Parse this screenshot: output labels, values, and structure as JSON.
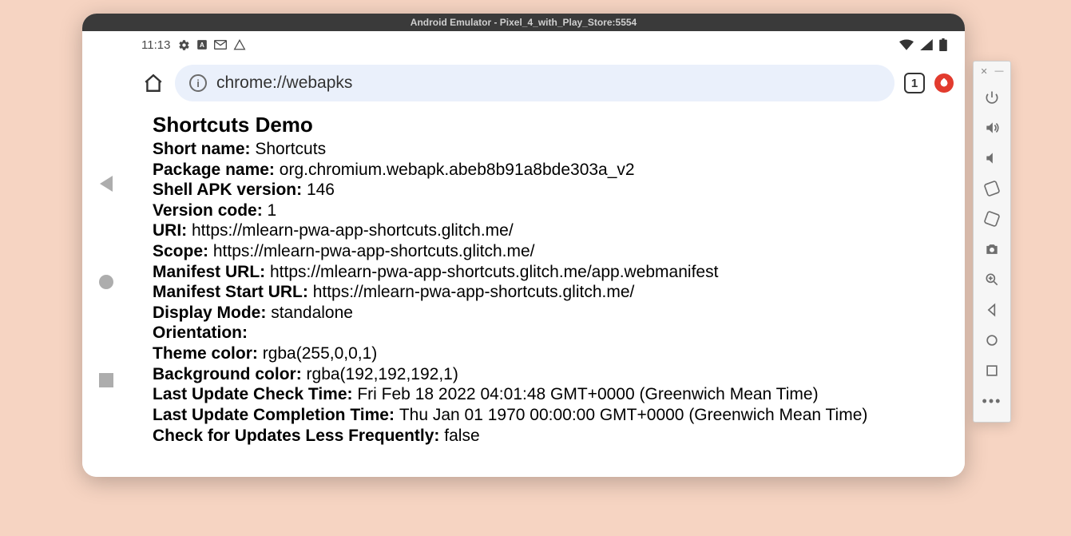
{
  "emulator": {
    "title": "Android Emulator - Pixel_4_with_Play_Store:5554"
  },
  "statusbar": {
    "time": "11:13"
  },
  "chrome": {
    "url": "chrome://webapks",
    "tab_count": "1"
  },
  "page": {
    "title": "Shortcuts Demo",
    "fields": [
      {
        "label": "Short name:",
        "value": "Shortcuts"
      },
      {
        "label": "Package name:",
        "value": "org.chromium.webapk.abeb8b91a8bde303a_v2"
      },
      {
        "label": "Shell APK version:",
        "value": "146"
      },
      {
        "label": "Version code:",
        "value": "1"
      },
      {
        "label": "URI:",
        "value": "https://mlearn-pwa-app-shortcuts.glitch.me/"
      },
      {
        "label": "Scope:",
        "value": "https://mlearn-pwa-app-shortcuts.glitch.me/"
      },
      {
        "label": "Manifest URL:",
        "value": "https://mlearn-pwa-app-shortcuts.glitch.me/app.webmanifest"
      },
      {
        "label": "Manifest Start URL:",
        "value": "https://mlearn-pwa-app-shortcuts.glitch.me/"
      },
      {
        "label": "Display Mode:",
        "value": "standalone"
      },
      {
        "label": "Orientation:",
        "value": ""
      },
      {
        "label": "Theme color:",
        "value": "rgba(255,0,0,1)"
      },
      {
        "label": "Background color:",
        "value": "rgba(192,192,192,1)"
      },
      {
        "label": "Last Update Check Time:",
        "value": "Fri Feb 18 2022 04:01:48 GMT+0000 (Greenwich Mean Time)"
      },
      {
        "label": "Last Update Completion Time:",
        "value": "Thu Jan 01 1970 00:00:00 GMT+0000 (Greenwich Mean Time)"
      },
      {
        "label": "Check for Updates Less Frequently:",
        "value": "false"
      }
    ]
  }
}
